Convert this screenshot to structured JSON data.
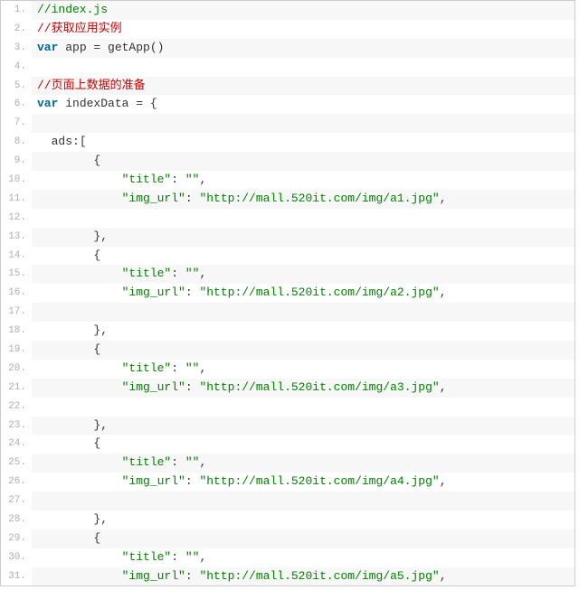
{
  "syntax": {
    "keyword_var": "var",
    "fn_getApp": "getApp",
    "id_app": "app",
    "id_indexData": "indexData",
    "id_ads": "ads"
  },
  "strings": {
    "key_title": "\"title\"",
    "key_img_url": "\"img_url\"",
    "empty": "\"\"",
    "url1": "\"http://mall.520it.com/img/a1.jpg\"",
    "url2": "\"http://mall.520it.com/img/a2.jpg\"",
    "url3": "\"http://mall.520it.com/img/a3.jpg\"",
    "url4": "\"http://mall.520it.com/img/a4.jpg\"",
    "url5": "\"http://mall.520it.com/img/a5.jpg\""
  },
  "comments": {
    "c1": "//index.js",
    "c2": "//获取应用实例",
    "c3": "//页面上数据的准备"
  },
  "lineNumbers": [
    "1.",
    "2.",
    "3.",
    "4.",
    "5.",
    "6.",
    "7.",
    "8.",
    "9.",
    "10.",
    "11.",
    "12.",
    "13.",
    "14.",
    "15.",
    "16.",
    "17.",
    "18.",
    "19.",
    "20.",
    "21.",
    "22.",
    "23.",
    "24.",
    "25.",
    "26.",
    "27.",
    "28.",
    "29.",
    "30.",
    "31."
  ]
}
